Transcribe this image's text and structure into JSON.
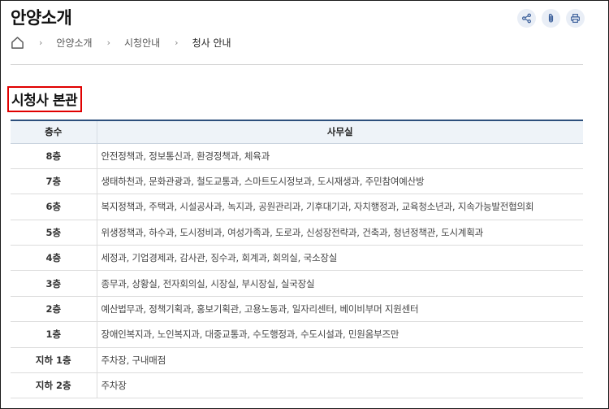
{
  "page": {
    "title": "안양소개",
    "actions": [
      {
        "icon": "share-icon"
      },
      {
        "icon": "paperclip-icon"
      },
      {
        "icon": "print-icon"
      }
    ]
  },
  "breadcrumb": {
    "home_icon": "home-icon",
    "items": [
      "안양소개",
      "시청안내",
      "청사 안내"
    ]
  },
  "section": {
    "title": "시청사 본관"
  },
  "table": {
    "headers": {
      "floor": "층수",
      "offices": "사무실"
    },
    "rows": [
      {
        "floor": "8층",
        "offices": "안전정책과, 정보통신과, 환경정책과, 체육과"
      },
      {
        "floor": "7층",
        "offices": "생태하천과, 문화관광과, 철도교통과, 스마트도시정보과, 도시재생과, 주민참여예산방"
      },
      {
        "floor": "6층",
        "offices": "복지정책과, 주택과, 시설공사과, 녹지과, 공원관리과, 기후대기과, 자치행정과, 교육청소년과, 지속가능발전협의회"
      },
      {
        "floor": "5층",
        "offices": "위생정책과, 하수과, 도시정비과, 여성가족과, 도로과, 신성장전략과, 건축과, 청년정책관, 도시계획과"
      },
      {
        "floor": "4층",
        "offices": "세정과, 기업경제과, 감사관, 징수과, 회계과, 회의실, 국소장실"
      },
      {
        "floor": "3층",
        "offices": "종무과, 상황실, 전자회의실, 시장실, 부시장실, 실국장실"
      },
      {
        "floor": "2층",
        "offices": "예산법무과, 정책기획과, 홍보기획관, 고용노동과, 일자리센터, 베이비부머 지원센터"
      },
      {
        "floor": "1층",
        "offices": "장애인복지과, 노인복지과, 대중교통과, 수도행정과, 수도시설과, 민원옴부즈만"
      },
      {
        "floor": "지하 1층",
        "offices": "주차장, 구내매점"
      },
      {
        "floor": "지하 2층",
        "offices": "주차장"
      }
    ]
  }
}
